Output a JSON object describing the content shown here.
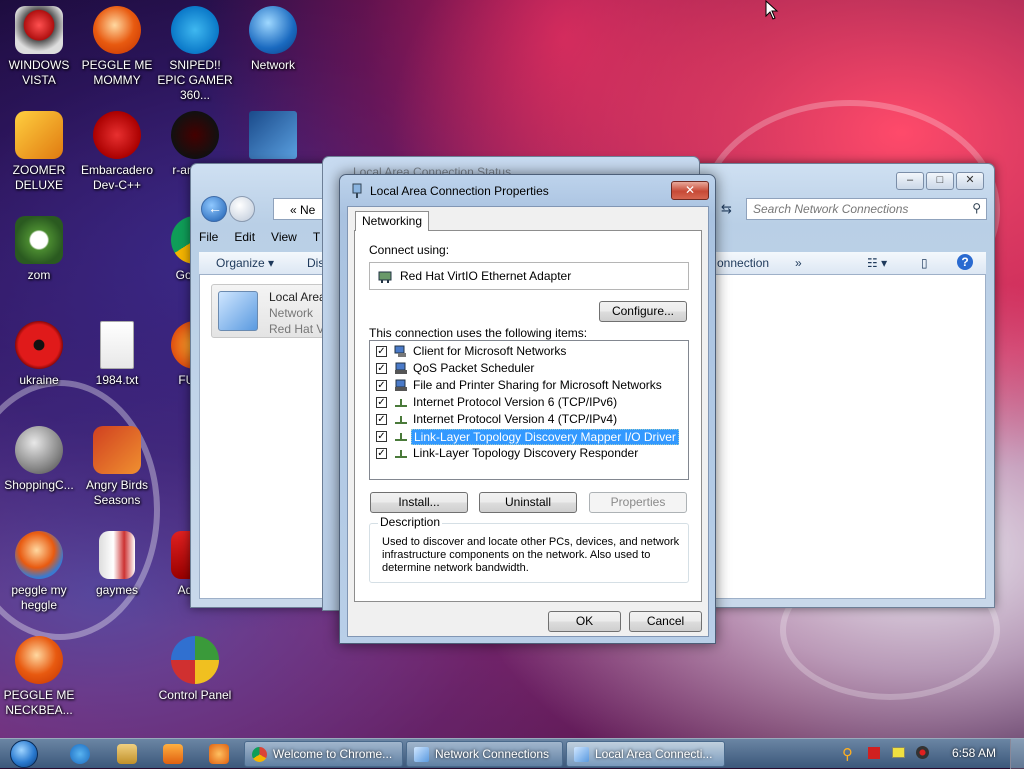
{
  "desktop": {
    "icons": [
      {
        "label": "WINDOWS VISTA"
      },
      {
        "label": "PEGGLE ME MOMMY"
      },
      {
        "label": "SNIPED!! EPIC GAMER 360..."
      },
      {
        "label": "Network"
      },
      {
        "label": "ZOOMER DELUXE"
      },
      {
        "label": "Embarcadero Dev-C++"
      },
      {
        "label": "r-ant par"
      },
      {
        "label": "zom"
      },
      {
        "label": "Go Chr"
      },
      {
        "label": "ukraine"
      },
      {
        "label": "1984.txt"
      },
      {
        "label": "FURR"
      },
      {
        "label": "ShoppingC..."
      },
      {
        "label": "Angry Birds Seasons"
      },
      {
        "label": "peggle my heggle"
      },
      {
        "label": "gaymes"
      },
      {
        "label": "Adobe"
      },
      {
        "label": "PEGGLE ME NECKBEA..."
      },
      {
        "label": "Control Panel"
      }
    ]
  },
  "explorer": {
    "address": "« Ne",
    "search_placeholder": "Search Network Connections",
    "menu": [
      "File",
      "Edit",
      "View",
      "T"
    ],
    "cmd": {
      "organize": "Organize ▾",
      "dis": "Dis",
      "connection": "onnection",
      "more": "»"
    },
    "item": {
      "name": "Local Area",
      "status": "Network",
      "device": "Red Hat Vi"
    }
  },
  "status_window": {
    "title": "Local Area Connection Status"
  },
  "dialog": {
    "title": "Local Area Connection Properties",
    "close": "✕",
    "tab": "Networking",
    "connect_using_label": "Connect using:",
    "adapter": "Red Hat VirtIO Ethernet Adapter",
    "configure_button": "Configure...",
    "items_label": "This connection uses the following items:",
    "items": [
      {
        "label": "Client for Microsoft Networks",
        "checked": true,
        "selected": false
      },
      {
        "label": "QoS Packet Scheduler",
        "checked": true,
        "selected": false
      },
      {
        "label": "File and Printer Sharing for Microsoft Networks",
        "checked": true,
        "selected": false
      },
      {
        "label": "Internet Protocol Version 6 (TCP/IPv6)",
        "checked": true,
        "selected": false
      },
      {
        "label": "Internet Protocol Version 4 (TCP/IPv4)",
        "checked": true,
        "selected": false
      },
      {
        "label": "Link-Layer Topology Discovery Mapper I/O Driver",
        "checked": true,
        "selected": true
      },
      {
        "label": "Link-Layer Topology Discovery Responder",
        "checked": true,
        "selected": false
      }
    ],
    "install_button": "Install...",
    "uninstall_button": "Uninstall",
    "properties_button": "Properties",
    "description_title": "Description",
    "description_text": "Used to discover and locate other PCs, devices, and network infrastructure components on the network.  Also used to determine network bandwidth.",
    "ok_button": "OK",
    "cancel_button": "Cancel"
  },
  "taskbar": {
    "tasks": [
      {
        "label": "Welcome to Chrome..."
      },
      {
        "label": "Network Connections"
      },
      {
        "label": "Local Area Connecti..."
      }
    ],
    "clock": "6:58 AM"
  }
}
